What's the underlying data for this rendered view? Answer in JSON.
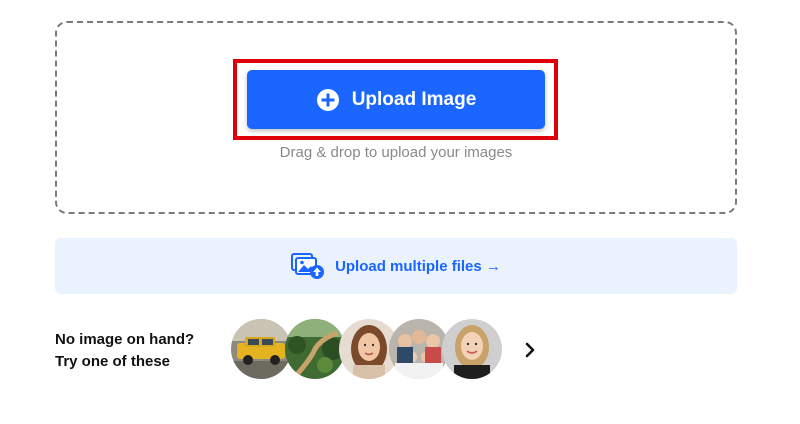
{
  "upload": {
    "button_label": "Upload Image",
    "drag_hint": "Drag & drop to upload your images",
    "button_icon": "plus-circle-icon",
    "button_color": "#1a66ff",
    "highlight_color": "#e0000b"
  },
  "multi": {
    "label": "Upload multiple files →",
    "icon": "images-upload-icon",
    "background": "#eaf2fd"
  },
  "samples": {
    "line1": "No image on hand?",
    "line2": "Try one of these",
    "thumbnails": [
      "yellow-car",
      "landscape-road",
      "woman-portrait",
      "family-photo",
      "smiling-woman"
    ],
    "next_icon": "chevron-right-icon"
  }
}
